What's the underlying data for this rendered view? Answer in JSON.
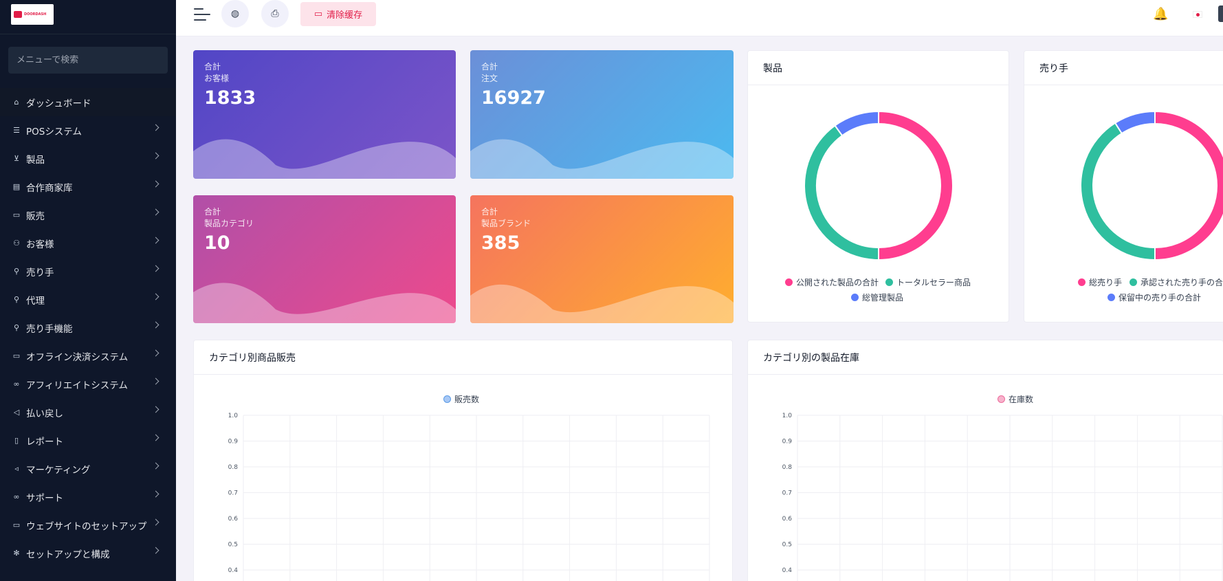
{
  "sidebar": {
    "logo_text": "DOORDASH",
    "search_placeholder": "メニューで検索",
    "items": [
      {
        "label": "ダッシュボード"
      },
      {
        "label": "POSシステム"
      },
      {
        "label": "製品"
      },
      {
        "label": "合作商家库"
      },
      {
        "label": "販売"
      },
      {
        "label": "お客様"
      },
      {
        "label": "売り手"
      },
      {
        "label": "代理"
      },
      {
        "label": "売り手機能"
      },
      {
        "label": "オフライン決済システム"
      },
      {
        "label": "アフィリエイトシステム"
      },
      {
        "label": "払い戻し"
      },
      {
        "label": "レポート"
      },
      {
        "label": "マーケティング"
      },
      {
        "label": "サポート"
      },
      {
        "label": "ウェブサイトのセットアップ"
      },
      {
        "label": "セットアップと構成"
      }
    ]
  },
  "topbar": {
    "clear_cache_label": "清除缓存"
  },
  "stats": [
    {
      "prefix": "合計",
      "label": "お客様",
      "value": "1833"
    },
    {
      "prefix": "合計",
      "label": "注文",
      "value": "16927"
    },
    {
      "prefix": "合計",
      "label": "製品カテゴリ",
      "value": "10"
    },
    {
      "prefix": "合計",
      "label": "製品ブランド",
      "value": "385"
    }
  ],
  "products_panel": {
    "title": "製品",
    "legend": [
      "公開された製品の合計",
      "トータルセラー商品",
      "総管理製品"
    ]
  },
  "sellers_panel": {
    "title": "売り手",
    "legend": [
      "総売り手",
      "承認された売り手の合計",
      "保留中の売り手の合計"
    ]
  },
  "sales_panel": {
    "title": "カテゴリ別商品販売",
    "legend": "販売数"
  },
  "stock_panel": {
    "title": "カテゴリ別の製品在庫",
    "legend": "在庫数"
  },
  "colors": {
    "pink": "#ff3d8f",
    "teal": "#2fbf9f",
    "blue": "#5b7cfa"
  },
  "chart_data": [
    {
      "type": "pie",
      "title": "製品",
      "labels": [
        "公開された製品の合計",
        "トータルセラー商品",
        "総管理製品"
      ],
      "values": [
        50,
        40,
        10
      ]
    },
    {
      "type": "pie",
      "title": "売り手",
      "labels": [
        "総売り手",
        "承認された売り手の合計",
        "保留中の売り手の合計"
      ],
      "values": [
        50,
        41,
        9
      ]
    },
    {
      "type": "bar",
      "title": "カテゴリ別商品販売",
      "series": [
        {
          "name": "販売数",
          "values": []
        }
      ],
      "yticks": [
        "1.0",
        "0.9",
        "0.8",
        "0.7",
        "0.6",
        "0.5",
        "0.4"
      ],
      "ylim": [
        0,
        1
      ]
    },
    {
      "type": "bar",
      "title": "カテゴリ別の製品在庫",
      "series": [
        {
          "name": "在庫数",
          "values": []
        }
      ],
      "yticks": [
        "1.0",
        "0.9",
        "0.8",
        "0.7",
        "0.6",
        "0.5",
        "0.4"
      ],
      "ylim": [
        0,
        1
      ]
    }
  ]
}
